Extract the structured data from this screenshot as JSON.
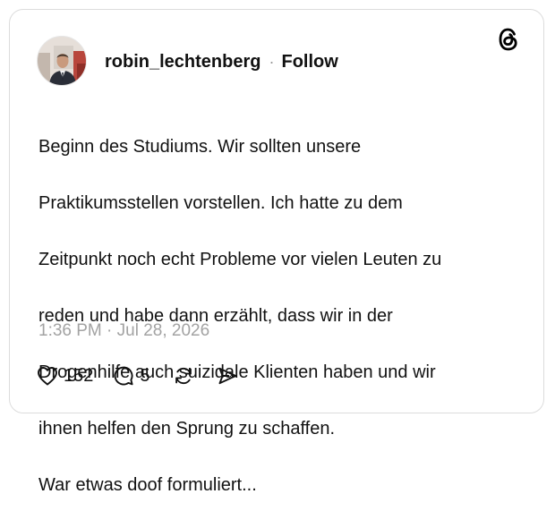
{
  "post": {
    "username": "robin_lechtenberg",
    "separator": "·",
    "follow_label": "Follow",
    "body_lines": [
      "Beginn des Studiums. Wir sollten unsere",
      "Praktikumsstellen vorstellen. Ich hatte zu dem",
      "Zeitpunkt noch echt Probleme vor vielen Leuten zu",
      "reden und habe dann erzählt, dass wir in der",
      "Drogenhilfe auch suizidale Klienten haben und wir",
      "ihnen helfen den Sprung zu schaffen.",
      "War etwas doof formuliert..."
    ],
    "timestamp": "1:36 PM · Jul 28, 2026"
  },
  "actions": {
    "like_icon": "heart-icon",
    "like_count": "152",
    "reply_icon": "speech-bubble-icon",
    "reply_count": "5",
    "repost_icon": "repost-icon",
    "share_icon": "send-icon"
  },
  "brand": {
    "logo": "threads-logo-icon"
  },
  "colors": {
    "text": "#111111",
    "muted": "#a3a3a3",
    "border": "#dcdcdc"
  }
}
